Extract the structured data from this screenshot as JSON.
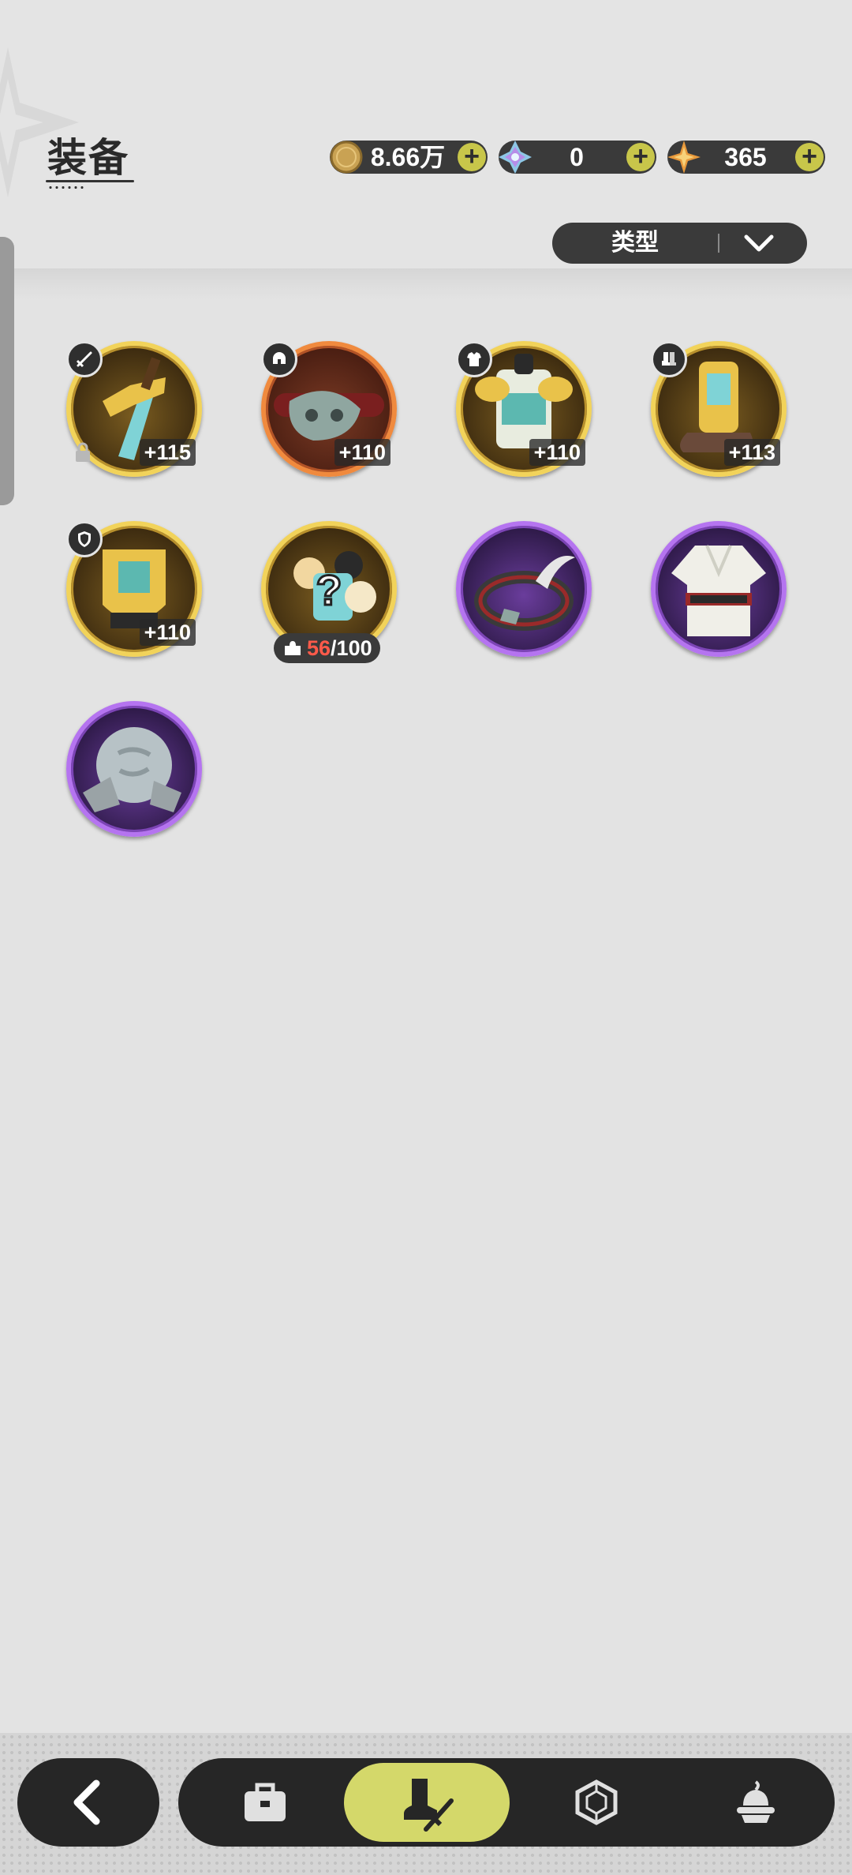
{
  "header": {
    "title": "装备"
  },
  "currencies": [
    {
      "icon": "gold-coin-icon",
      "value": "8.66万"
    },
    {
      "icon": "crystal-gem-icon",
      "value": "0"
    },
    {
      "icon": "star-shard-icon",
      "value": "365"
    }
  ],
  "filter": {
    "label": "类型",
    "icon": "chevron-down-icon"
  },
  "items": [
    {
      "name": "sword",
      "rarity": "gold",
      "slot": "sword-icon",
      "level": "+115",
      "locked": true
    },
    {
      "name": "helmet",
      "rarity": "orange",
      "slot": "helmet-icon",
      "level": "+110"
    },
    {
      "name": "armor",
      "rarity": "gold",
      "slot": "armor-icon",
      "level": "+110"
    },
    {
      "name": "boots",
      "rarity": "gold",
      "slot": "boots-icon",
      "level": "+113"
    },
    {
      "name": "shield",
      "rarity": "gold",
      "slot": "shield-icon",
      "level": "+110"
    },
    {
      "name": "mystery-shard",
      "rarity": "gold",
      "shards_current": "56",
      "shards_total": "/100"
    },
    {
      "name": "headband",
      "rarity": "purple"
    },
    {
      "name": "robe",
      "rarity": "purple"
    },
    {
      "name": "stone",
      "rarity": "purple"
    }
  ],
  "nav": {
    "tabs": [
      "back",
      "bag",
      "equipment",
      "gem",
      "pudding"
    ],
    "active": "equipment"
  },
  "colors": {
    "gold_border": "#f2d35a",
    "orange_border": "#f08a3e",
    "purple_border": "#b574f0",
    "plus_button": "#c8c64a",
    "nav_active": "#d4d86a",
    "shard_count": "#ff5a4a"
  }
}
